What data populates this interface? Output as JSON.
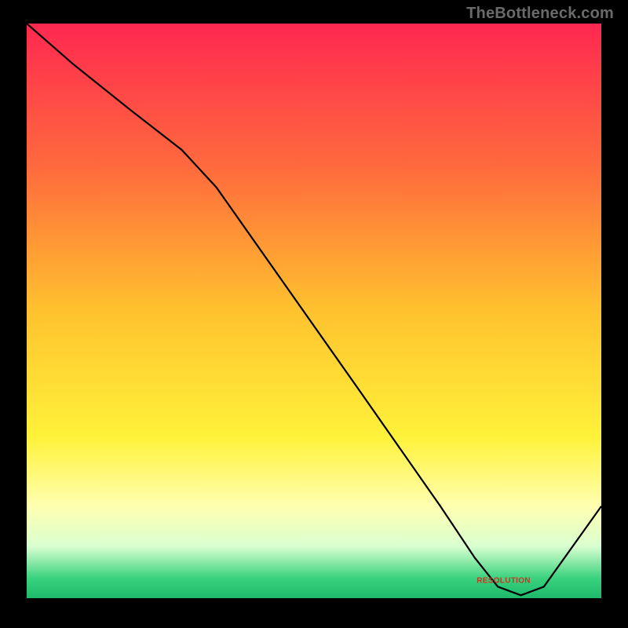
{
  "watermark": "TheBottleneck.com",
  "chart_data": {
    "type": "line",
    "title": "",
    "xlabel": "",
    "ylabel": "",
    "xlim": [
      0,
      100
    ],
    "ylim": [
      0,
      100
    ],
    "background_gradient": {
      "stops": [
        {
          "offset": 0.0,
          "color": "#ff2850"
        },
        {
          "offset": 0.25,
          "color": "#ff6a3d"
        },
        {
          "offset": 0.5,
          "color": "#ffc22e"
        },
        {
          "offset": 0.72,
          "color": "#fff23a"
        },
        {
          "offset": 0.84,
          "color": "#ffffb0"
        },
        {
          "offset": 0.91,
          "color": "#d9ffd0"
        },
        {
          "offset": 0.965,
          "color": "#3ad27e"
        },
        {
          "offset": 1.0,
          "color": "#1db96a"
        }
      ]
    },
    "series": [
      {
        "name": "bottleneck-curve",
        "color": "#000000",
        "x": [
          0,
          8,
          18,
          27,
          33,
          58,
          72,
          78,
          82,
          86,
          90,
          100
        ],
        "values": [
          100,
          93,
          85,
          78,
          71.5,
          36,
          16,
          7,
          2,
          0.5,
          2,
          16
        ]
      }
    ],
    "annotations": [
      {
        "name": "series-label",
        "text": "RESOLUTION",
        "x": 83,
        "y": 3
      }
    ]
  }
}
